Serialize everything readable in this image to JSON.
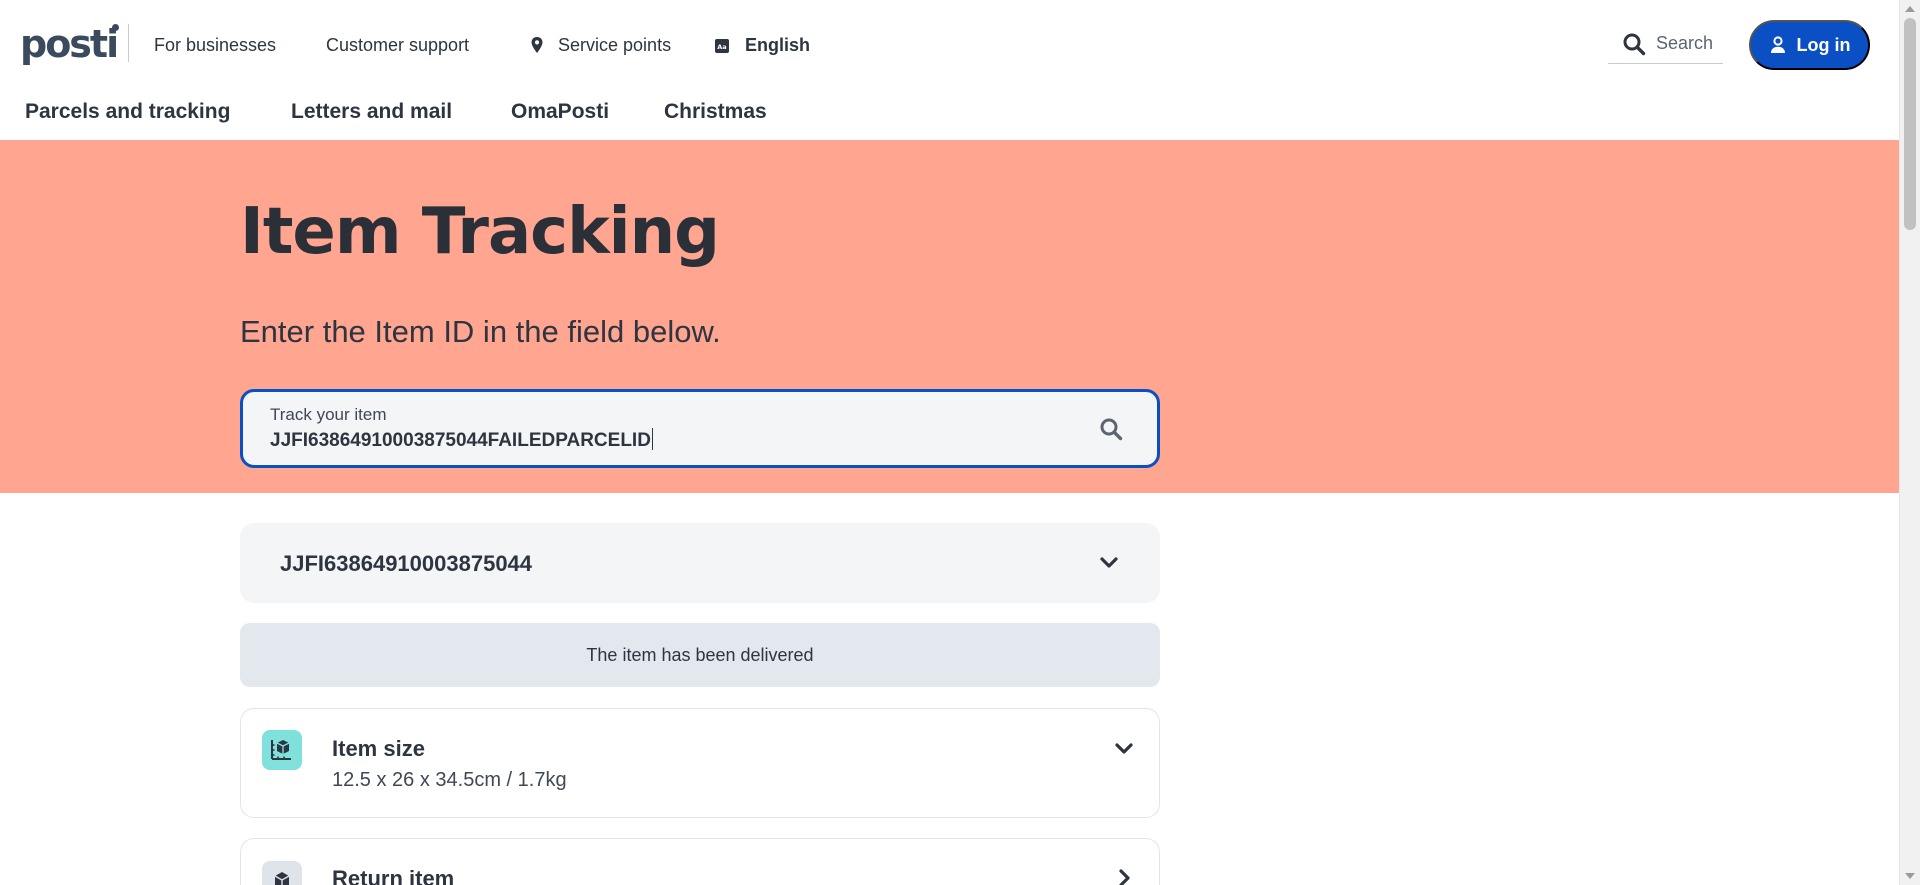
{
  "header": {
    "logo_text": "posti",
    "utility_links": [
      "For businesses",
      "Customer support",
      "Service points"
    ],
    "language": "English",
    "search_label": "Search",
    "login_label": "Log in"
  },
  "nav": {
    "items": [
      "Parcels and tracking",
      "Letters and mail",
      "OmaPosti",
      "Christmas"
    ]
  },
  "hero": {
    "title": "Item Tracking",
    "subtitle": "Enter the Item ID in the field below.",
    "field_label": "Track your item",
    "field_value": "JJFI63864910003875044FAILEDPARCELID"
  },
  "result": {
    "item_id": "JJFI63864910003875044",
    "status": "The item has been delivered",
    "cards": [
      {
        "title": "Item size",
        "description": "12.5 x 26 x 34.5cm / 1.7kg",
        "icon": "box-measure-icon"
      },
      {
        "title": "Return item",
        "icon": "return-box-icon"
      }
    ]
  },
  "colors": {
    "hero_bg": "#ffa590",
    "primary_blue": "#0a4fc4",
    "text_dark": "#2e3540",
    "status_bg": "#e3e8ef",
    "size_icon_bg": "#7fe0dc"
  }
}
